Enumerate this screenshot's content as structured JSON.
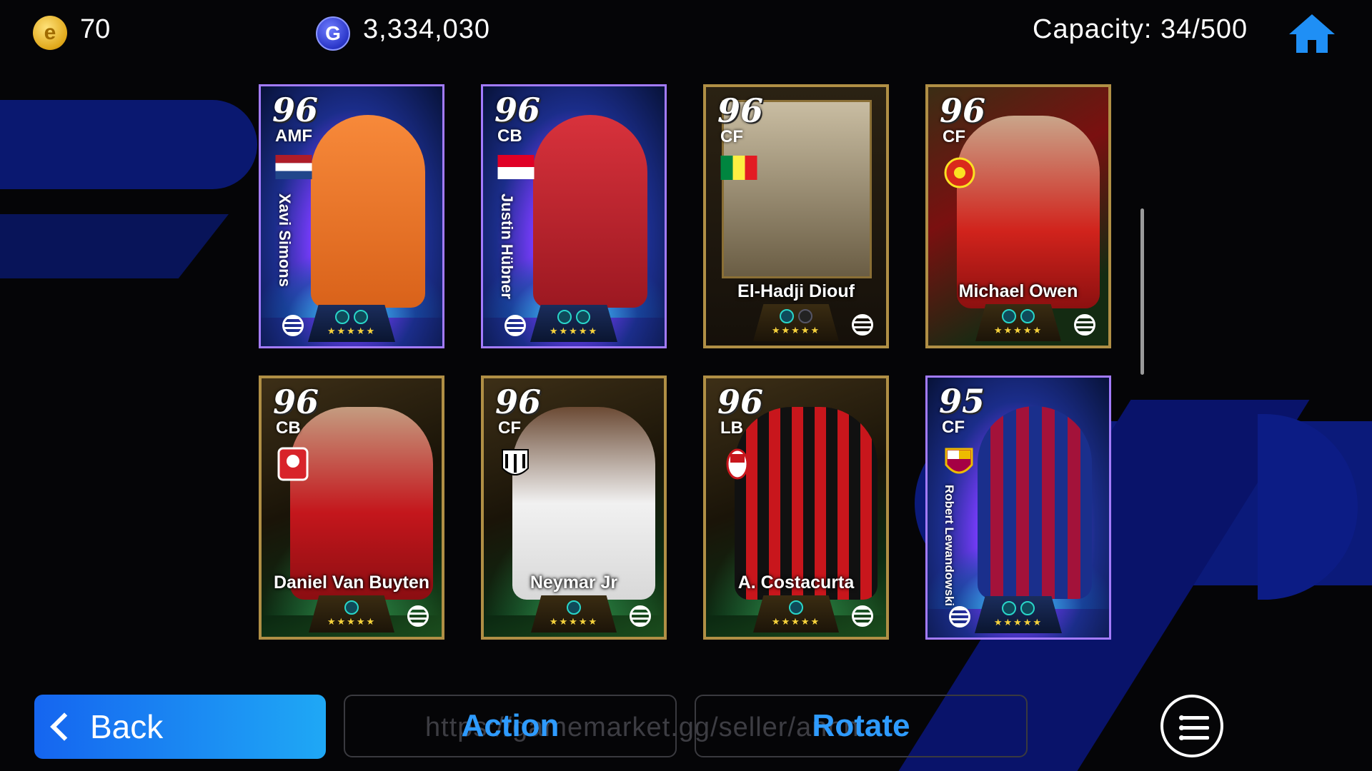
{
  "topbar": {
    "coin_icon": "efootball-coin-icon",
    "coins": "70",
    "gp_icon": "gp-icon",
    "gp": "3,334,030",
    "capacity": "Capacity: 34/500",
    "home_icon": "home-icon"
  },
  "cards": [
    {
      "rating": "96",
      "position": "AMF",
      "name": "Xavi Simons",
      "style": "big",
      "stars": "★★★★★"
    },
    {
      "rating": "96",
      "position": "CB",
      "name": "Justin Hübner",
      "style": "big",
      "stars": "★★★★★"
    },
    {
      "rating": "96",
      "position": "CF",
      "name": "El-Hadji Diouf",
      "style": "classic",
      "stars": "★★★★★"
    },
    {
      "rating": "96",
      "position": "CF",
      "name": "Michael Owen",
      "style": "owen",
      "stars": "★★★★★"
    },
    {
      "rating": "96",
      "position": "CB",
      "name": "Daniel Van Buyten",
      "style": "legend",
      "stars": "★★★★★"
    },
    {
      "rating": "96",
      "position": "CF",
      "name": "Neymar Jr",
      "style": "legend",
      "stars": "★★★★★"
    },
    {
      "rating": "96",
      "position": "LB",
      "name": "A. Costacurta",
      "style": "legend",
      "stars": "★★★★★"
    },
    {
      "rating": "95",
      "position": "CF",
      "name": "Robert Lewandowski",
      "style": "big",
      "stars": "★★★★★"
    }
  ],
  "bottom": {
    "back": "Back",
    "action": "Action",
    "rotate": "Rotate",
    "watermark": "https://gamemarket.gg/seller/anhn"
  },
  "colors": {
    "accent_blue": "#1f8ff5",
    "card_gold": "#b08f45",
    "card_purple": "#a37bff"
  }
}
